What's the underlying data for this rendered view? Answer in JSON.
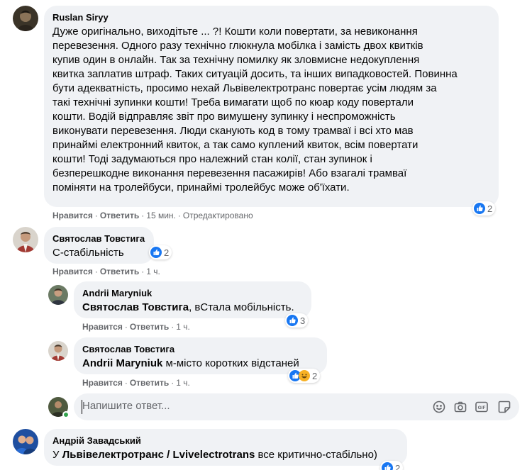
{
  "comments": [
    {
      "author": "Ruslan Siryy",
      "text": "Дуже оригінально, виходітьте ... ?! Кошти коли повертати, за невиконання перевезення. Одного разу технічно глюкнула мобілка і замість двох квитків купив один в онлайн. Так за технічну помилку як зловмисне недокуплення квитка заплатив штраф. Таких ситуацій досить, та інших випадковостей. Повинна бути адекватність, просимо нехай Львівелектротранс повертає усім людям за такі технічні зупинки кошти! Треба вимагати щоб по кюар коду повертали кошти. Водій відправляє звіт про вимушену зупинку і неспроможність виконувати перевезення. Люди сканують код в тому трамваї і всі хто мав принаймі електронний квиток, а так само куплений квиток, всім повертати кошти! Тоді задумаються про належний стан колії, стан зупинок і безперешкодне виконання перевезення пасажирів! Або взагалі трамваї поміняти на тролейбуси, принаймі тролейбус може об'їхати.",
      "lines": [
        "Дуже оригінально, виходітьте ... ?! Кошти коли повертати, за невиконання",
        "перевезення. Одного разу технічно глюкнула мобілка і замість двох квитків",
        "купив один в онлайн. Так за технічну помилку як зловмисне недокуплення",
        "квитка заплатив штраф. Таких ситуацій досить, та інших випадковостей. Повинна",
        "бути адекватність, просимо нехай Львівелектротранс повертає усім людям за",
        "такі технічні зупинки кошти! Треба вимагати щоб по кюар коду повертали",
        "кошти. Водій відправляє звіт про вимушену зупинку і неспроможність",
        "виконувати перевезення. Люди сканують код в тому трамваї і всі хто мав",
        "принаймі електронний квиток, а так само куплений квиток, всім повертати",
        "кошти! Тоді задумаються про належний стан колії, стан зупинок і",
        "безперешкодне виконання перевезення пасажирів! Або взагалі трамваї",
        "поміняти на тролейбуси, принаймі тролейбус може об'їхати."
      ],
      "like": "Нравится",
      "reply": "Ответить",
      "time": "15 мин.",
      "edited": "Отредактировано",
      "reactions": "2"
    },
    {
      "author": "Святослав Товстига",
      "text": "С-стабільність",
      "like": "Нравится",
      "reply": "Ответить",
      "time": "1 ч.",
      "reactions": "2"
    }
  ],
  "replies": [
    {
      "author": "Andrii Maryniuk",
      "mention": "Святослав Товстига",
      "text": ", вСтала мобільність.",
      "like": "Нравится",
      "reply": "Ответить",
      "time": "1 ч.",
      "reactions": "3"
    },
    {
      "author": "Святослав Товстига",
      "mention": "Andrii Maryniuk",
      "text": " м-місто коротких відстаней",
      "like": "Нравится",
      "reply": "Ответить",
      "time": "1 ч.",
      "reactions": "2"
    }
  ],
  "reply_box": {
    "placeholder": "Напишите ответ..."
  },
  "last_comment": {
    "author": "Андрій Завадський",
    "prefix": "У ",
    "mention": "Львівелектротранс / Lvivelectrotrans",
    "text": " все критично-стабільно)",
    "reactions": "2"
  },
  "dot": "·",
  "icons": [
    "like-icon",
    "haha-icon",
    "emoji-icon",
    "camera-icon",
    "gif-icon",
    "sticker-icon"
  ]
}
